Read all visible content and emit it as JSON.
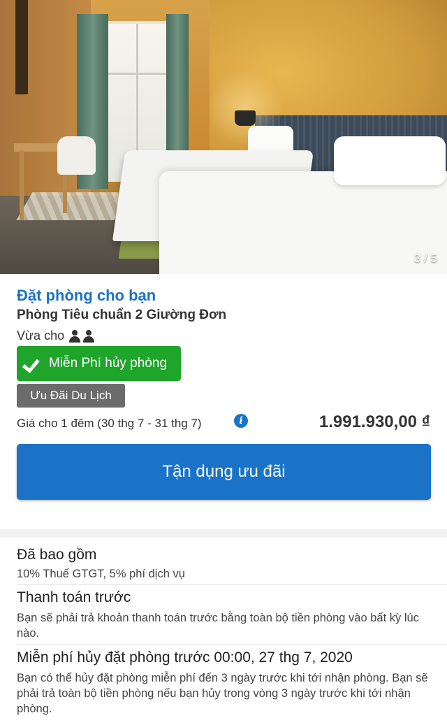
{
  "photo": {
    "counter": "3 / 5"
  },
  "offer": {
    "title": "Đặt phòng cho bạn",
    "room_name": "Phòng Tiêu chuẩn 2 Giường Đơn",
    "fits_label": "Vừa cho",
    "free_cancel_badge": "Miễn Phí hủy phòng",
    "deal_tag": "Ưu Đãi Du Lịch",
    "price_label": "Giá cho 1 đêm (30 thg 7 - 31 thg 7)",
    "price": "1.991.930,00 ₫",
    "cta_label": "Tận dụng ưu đãi"
  },
  "details": [
    {
      "heading": "Đã bao gồm",
      "body": "10% Thuế GTGT, 5% phí dịch vụ"
    },
    {
      "heading": "Thanh toán trước",
      "body": "Bạn sẽ phải trả khoản thanh toán trước bằng toàn bộ tiền phòng vào bất kỳ lúc nào."
    },
    {
      "heading": "Miễn phí hủy đặt phòng trước 00:00, 27 thg 7, 2020",
      "body": "Bạn có thể hủy đặt phòng miễn phí đến 3 ngày trước khi tới nhận phòng. Bạn sẽ phải trả toàn bộ tiền phòng nếu bạn hủy trong vòng 3 ngày trước khi tới nhận phòng."
    }
  ],
  "colors": {
    "accent": "#1a73c7",
    "success": "#1fa52b",
    "tag": "#6b6b6b"
  },
  "icons": {
    "guests": "two-persons-icon",
    "check": "checkmark-icon",
    "info": "info-icon"
  }
}
